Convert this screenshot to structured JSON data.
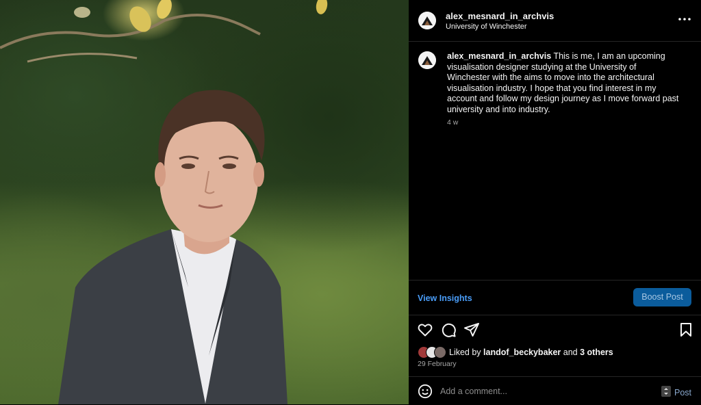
{
  "post": {
    "username": "alex_mesnard_in_archvis",
    "location": "University of Winchester",
    "caption": "This is me, I am an upcoming visualisation designer studying at the University of Winchester with the aims to move into the architectural visualisation industry. I hope that you find interest in my account and follow my design journey as I move forward past university and into industry.",
    "time_ago": "4 w",
    "date": "29 February"
  },
  "insights": {
    "view_label": "View Insights",
    "boost_label": "Boost Post"
  },
  "likes": {
    "prefix": "Liked by",
    "first_user": "landof_beckybaker",
    "joiner": "and",
    "others": "3 others"
  },
  "comment": {
    "placeholder": "Add a comment...",
    "post_label": "Post"
  },
  "icons": {
    "more": "more-options-icon",
    "like": "heart-icon",
    "comment": "comment-icon",
    "share": "send-icon",
    "save": "bookmark-icon",
    "emoji": "emoji-icon"
  },
  "colors": {
    "link": "#4a9df8",
    "boost_bg": "#0b5c9c",
    "panel_bg": "#000000",
    "muted": "#a8a8a8"
  }
}
